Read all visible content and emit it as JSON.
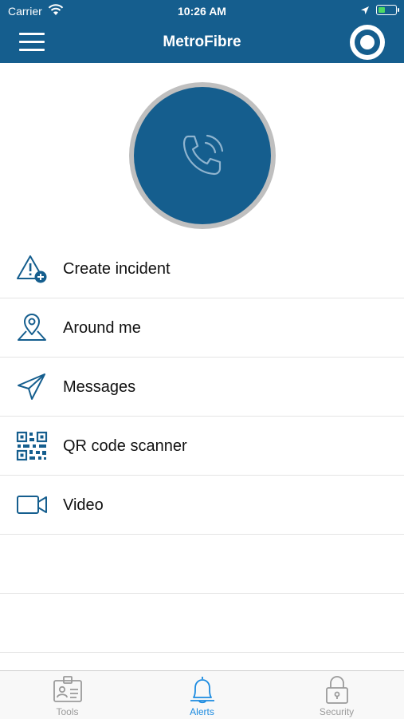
{
  "status_bar": {
    "carrier": "Carrier",
    "time": "10:26 AM"
  },
  "header": {
    "title": "MetroFibre"
  },
  "menu": {
    "items": [
      {
        "label": "Create incident",
        "icon": "alert-triangle-plus-icon"
      },
      {
        "label": "Around me",
        "icon": "location-pin-icon"
      },
      {
        "label": "Messages",
        "icon": "paper-plane-icon"
      },
      {
        "label": "QR code scanner",
        "icon": "qr-code-icon"
      },
      {
        "label": "Video",
        "icon": "video-camera-icon"
      }
    ]
  },
  "tabs": [
    {
      "label": "Tools",
      "icon": "id-card-icon",
      "active": false
    },
    {
      "label": "Alerts",
      "icon": "bell-icon",
      "active": true
    },
    {
      "label": "Security",
      "icon": "lock-icon",
      "active": false
    }
  ],
  "colors": {
    "primary": "#155e8e",
    "active_tab": "#1a8ae0",
    "inactive_tab": "#9a9a9a"
  }
}
